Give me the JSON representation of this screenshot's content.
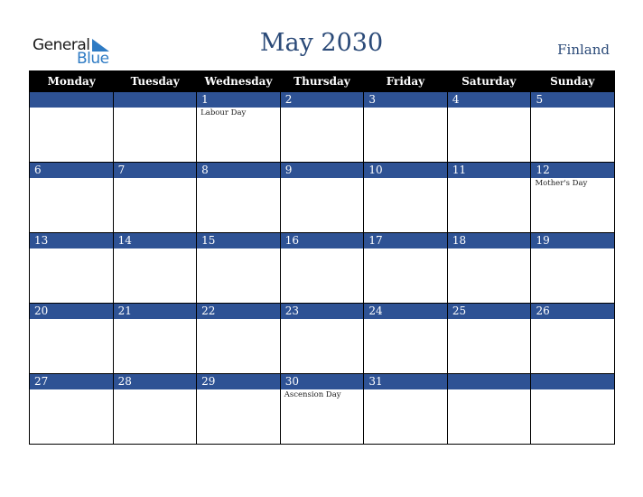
{
  "logo": {
    "word1": "General",
    "word2": "Blue"
  },
  "header": {
    "title": "May 2030",
    "country": "Finland"
  },
  "colors": {
    "header_bg": "#000000",
    "day_band": "#2e5294",
    "title": "#2b4a78",
    "logo_blue": "#2e7bc4"
  },
  "weekdays": [
    "Monday",
    "Tuesday",
    "Wednesday",
    "Thursday",
    "Friday",
    "Saturday",
    "Sunday"
  ],
  "weeks": [
    [
      {
        "day": "",
        "event": ""
      },
      {
        "day": "",
        "event": ""
      },
      {
        "day": "1",
        "event": "Labour Day"
      },
      {
        "day": "2",
        "event": ""
      },
      {
        "day": "3",
        "event": ""
      },
      {
        "day": "4",
        "event": ""
      },
      {
        "day": "5",
        "event": ""
      }
    ],
    [
      {
        "day": "6",
        "event": ""
      },
      {
        "day": "7",
        "event": ""
      },
      {
        "day": "8",
        "event": ""
      },
      {
        "day": "9",
        "event": ""
      },
      {
        "day": "10",
        "event": ""
      },
      {
        "day": "11",
        "event": ""
      },
      {
        "day": "12",
        "event": "Mother's Day"
      }
    ],
    [
      {
        "day": "13",
        "event": ""
      },
      {
        "day": "14",
        "event": ""
      },
      {
        "day": "15",
        "event": ""
      },
      {
        "day": "16",
        "event": ""
      },
      {
        "day": "17",
        "event": ""
      },
      {
        "day": "18",
        "event": ""
      },
      {
        "day": "19",
        "event": ""
      }
    ],
    [
      {
        "day": "20",
        "event": ""
      },
      {
        "day": "21",
        "event": ""
      },
      {
        "day": "22",
        "event": ""
      },
      {
        "day": "23",
        "event": ""
      },
      {
        "day": "24",
        "event": ""
      },
      {
        "day": "25",
        "event": ""
      },
      {
        "day": "26",
        "event": ""
      }
    ],
    [
      {
        "day": "27",
        "event": ""
      },
      {
        "day": "28",
        "event": ""
      },
      {
        "day": "29",
        "event": ""
      },
      {
        "day": "30",
        "event": "Ascension Day"
      },
      {
        "day": "31",
        "event": ""
      },
      {
        "day": "",
        "event": ""
      },
      {
        "day": "",
        "event": ""
      }
    ]
  ]
}
